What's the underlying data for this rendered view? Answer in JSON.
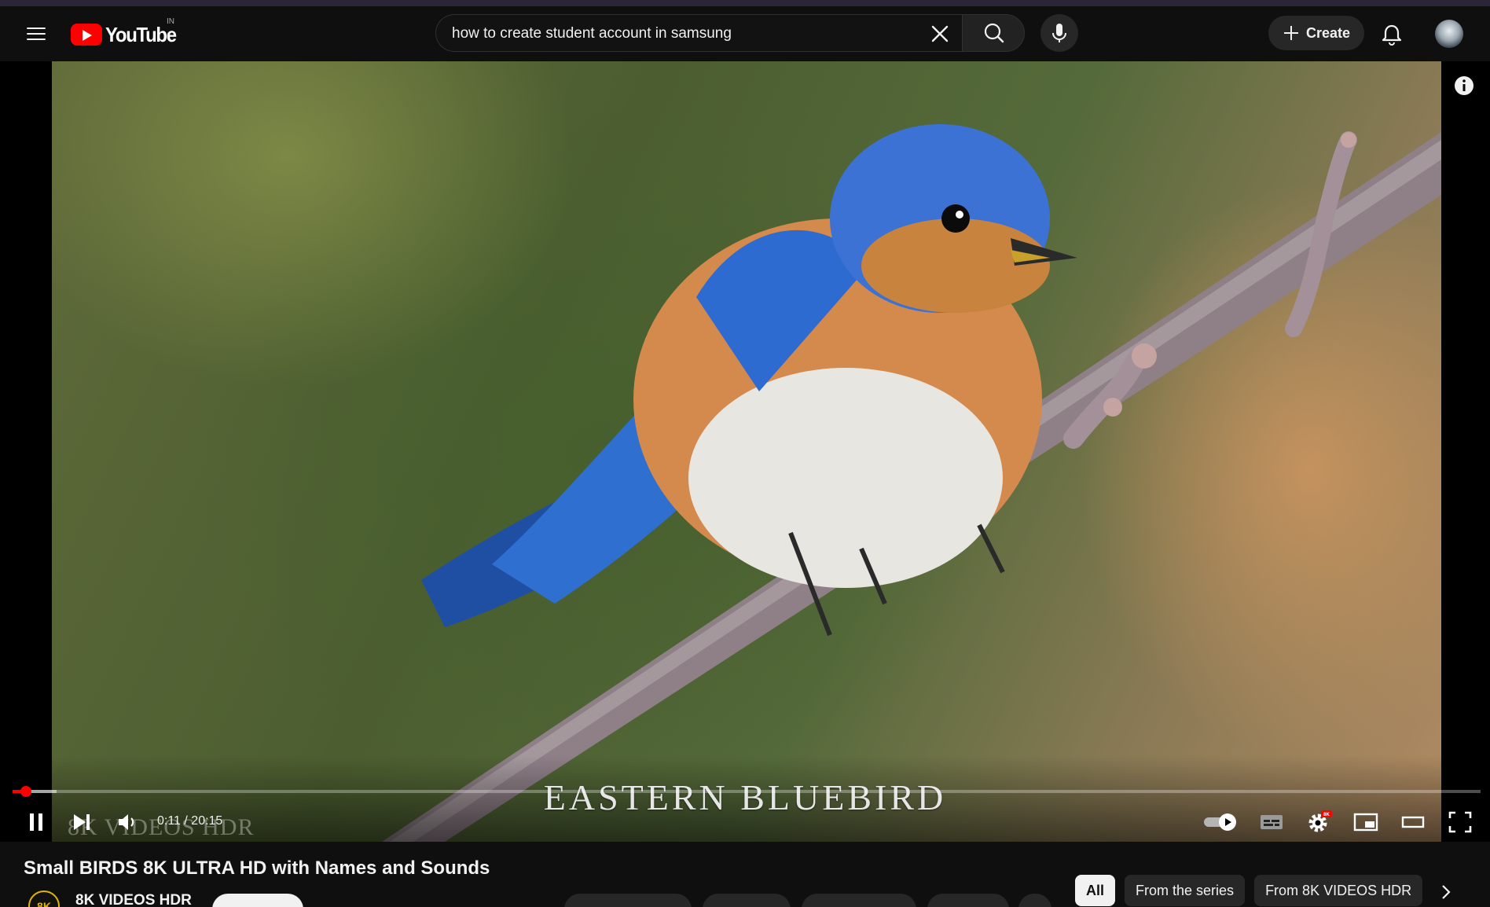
{
  "header": {
    "logo_text": "YouTube",
    "country_code": "IN",
    "search_value": "how to create student account in samsung",
    "create_label": "Create"
  },
  "player": {
    "overlay_caption": "EASTERN BLUEBIRD",
    "watermark": "8K VIDEOS HDR",
    "current_time": "0:11",
    "duration": "20:15",
    "time_display": "0:11 / 20:15",
    "progress_fraction": 0.009,
    "buffered_fraction": 0.03,
    "settings_badge": "8K",
    "autoplay_on": true
  },
  "video": {
    "title": "Small BIRDS 8K ULTRA HD with Names and Sounds",
    "channel_name": "8K VIDEOS HDR",
    "channel_avatar_text": "8K"
  },
  "chips": [
    {
      "label": "All",
      "active": true
    },
    {
      "label": "From the series",
      "active": false
    },
    {
      "label": "From 8K VIDEOS HDR",
      "active": false
    }
  ],
  "colors": {
    "brand_red": "#ff0000",
    "background": "#0f0f0f",
    "chip_bg": "#272727"
  }
}
